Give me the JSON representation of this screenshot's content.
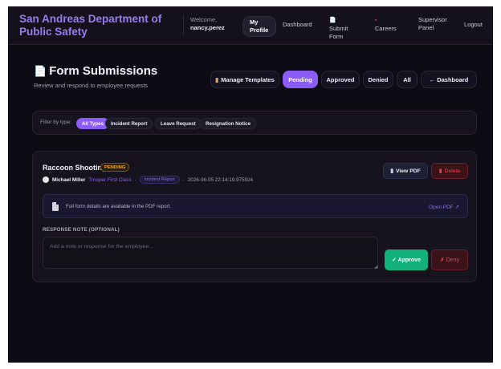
{
  "nav": {
    "brand": "San Andreas Department of Public Safety",
    "welcome_prefix": "Welcome,",
    "username": "nancy.perez",
    "items": [
      {
        "label": "My Profile"
      },
      {
        "label": "Dashboard"
      },
      {
        "label": "Submit Form",
        "icon": "form-icon"
      },
      {
        "label": "Careers",
        "icon": "briefcase-icon"
      },
      {
        "label": "Supervisor Panel"
      },
      {
        "label": "Logout"
      }
    ]
  },
  "page": {
    "title": "Form Submissions",
    "subtitle": "Review and respond to employee requests",
    "buttons": {
      "manage_templates": "Manage Templates",
      "pending": "Pending",
      "approved": "Approved",
      "denied": "Denied",
      "all": "All",
      "dashboard": "← Dashboard"
    }
  },
  "filter": {
    "label": "Filter by type:",
    "chips": [
      "All Types",
      "Incident Report",
      "Leave Request",
      "Resignation Notice"
    ],
    "active": "All Types"
  },
  "submission": {
    "title": "Raccoon Shooting",
    "status": "PENDING",
    "employee_name": "Michael Miller",
    "employee_rank": "Trooper First Class",
    "form_type": "Incident Report",
    "separator": "·",
    "timestamp": "2026-06-05 22:14:19.975924",
    "view_pdf_label": "View PDF",
    "delete_label": "Delete",
    "pdf_notice": "Full form details are available in the PDF report.",
    "open_pdf_label": "Open PDF ↗",
    "response_note_label": "RESPONSE NOTE (OPTIONAL)",
    "response_note_placeholder": "Add a note or response for the employee...",
    "response_note_value": "",
    "approve_label": "✓ Approve",
    "deny_label": "✗ Deny"
  },
  "colors": {
    "accent": "#8b5cf6",
    "approve": "#12b07a",
    "danger": "#ef4458",
    "pending": "#f5a524",
    "background": "#0d0b14"
  }
}
